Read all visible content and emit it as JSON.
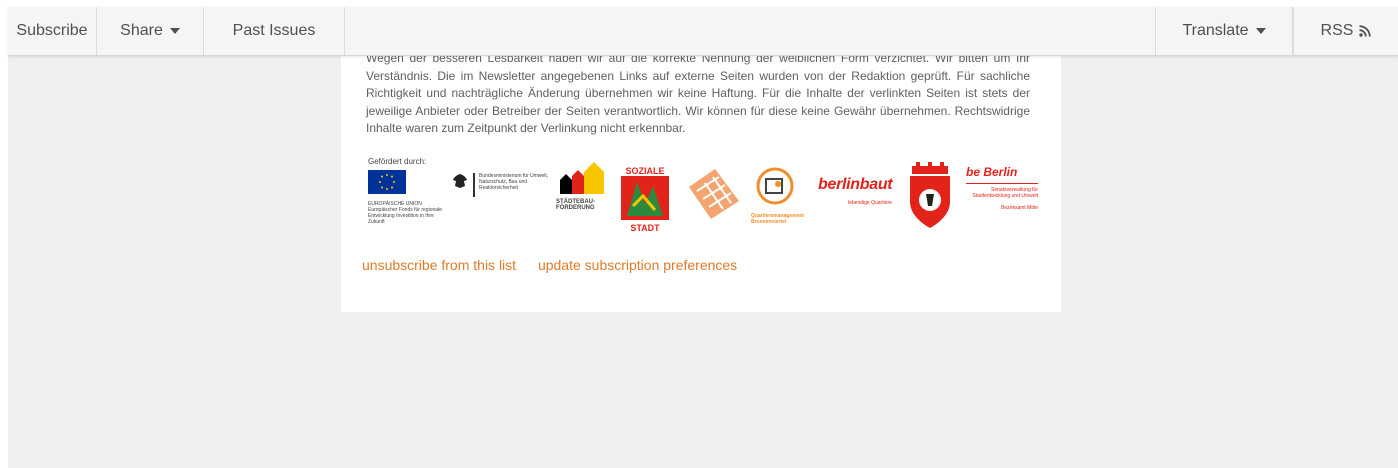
{
  "topbar": {
    "subscribe": "Subscribe",
    "share": "Share",
    "past_issues": "Past Issues",
    "translate": "Translate",
    "rss": "RSS"
  },
  "content": {
    "disclaimer_top": "Wegen der besseren Lesbarkeit haben wir auf die korrekte Nennung der weiblichen Form verzichtet. Wir bitten",
    "disclaimer": "um Ihr Verständnis. Die im Newsletter angegebenen Links auf externe Seiten wurden von der Redaktion geprüft. Für sachliche Richtigkeit und nachträgliche Änderung übernehmen wir keine Haftung. Für die Inhalte der verlinkten Seiten ist stets der jeweilige Anbieter oder Betreiber der Seiten verantwortlich. Wir können für diese keine Gewähr übernehmen. Rechtswidrige Inhalte waren zum Zeitpunkt der Verlinkung nicht erkennbar.",
    "funded_by": "Gefördert durch:",
    "eu_text": "EUROPÄISCHE UNION Europäischer Fonds für regionale Entwicklung Investition in Ihre Zukunft",
    "bmub_text": "Bundesministerium für Umwelt, Naturschutz, Bau und Reaktorsicherheit",
    "staedtebau_text": "STÄDTEBAU-FÖRDERUNG",
    "soziale_top": "SOZIALE",
    "soziale_bottom": "STADT",
    "qm_text": "Quartiersmanagement Brunnenviertel",
    "berlinbaut_text": "berlinbaut",
    "berlinbaut_sub": "lebendige Quartiere",
    "beberlin_text": "be Berlin",
    "senat_text": "Senatsverwaltung für Stadtentwicklung und Umwelt",
    "bezirk_text": "Bezirksamt Mitte"
  },
  "footer_links": {
    "unsubscribe": "unsubscribe from this list",
    "update": "update subscription preferences"
  },
  "colors": {
    "link": "#e07b28",
    "eu_blue": "#003399",
    "eu_star": "#ffcc00"
  }
}
